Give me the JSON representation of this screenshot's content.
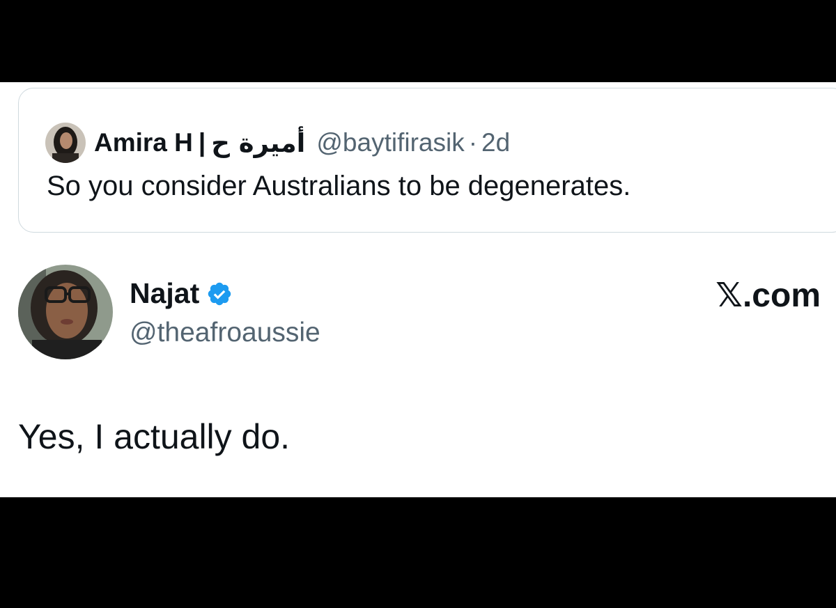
{
  "quoted_tweet": {
    "author_name": "Amira H",
    "separator": "|",
    "author_name_arabic": "أميرة ح",
    "handle": "@baytifirasik",
    "dot": "·",
    "time": "2d",
    "text": "So you consider Australians to be degenerates."
  },
  "tweet": {
    "author_name": "Najat",
    "verified_icon": "verified-badge-icon",
    "handle": "@theafroaussie",
    "brand": "𝕏.com",
    "text": "Yes, I actually do."
  },
  "colors": {
    "background": "#000000",
    "card": "#ffffff",
    "text_primary": "#0f1419",
    "text_secondary": "#536471",
    "verified_blue": "#1d9bf0",
    "border": "#cfd9de"
  }
}
